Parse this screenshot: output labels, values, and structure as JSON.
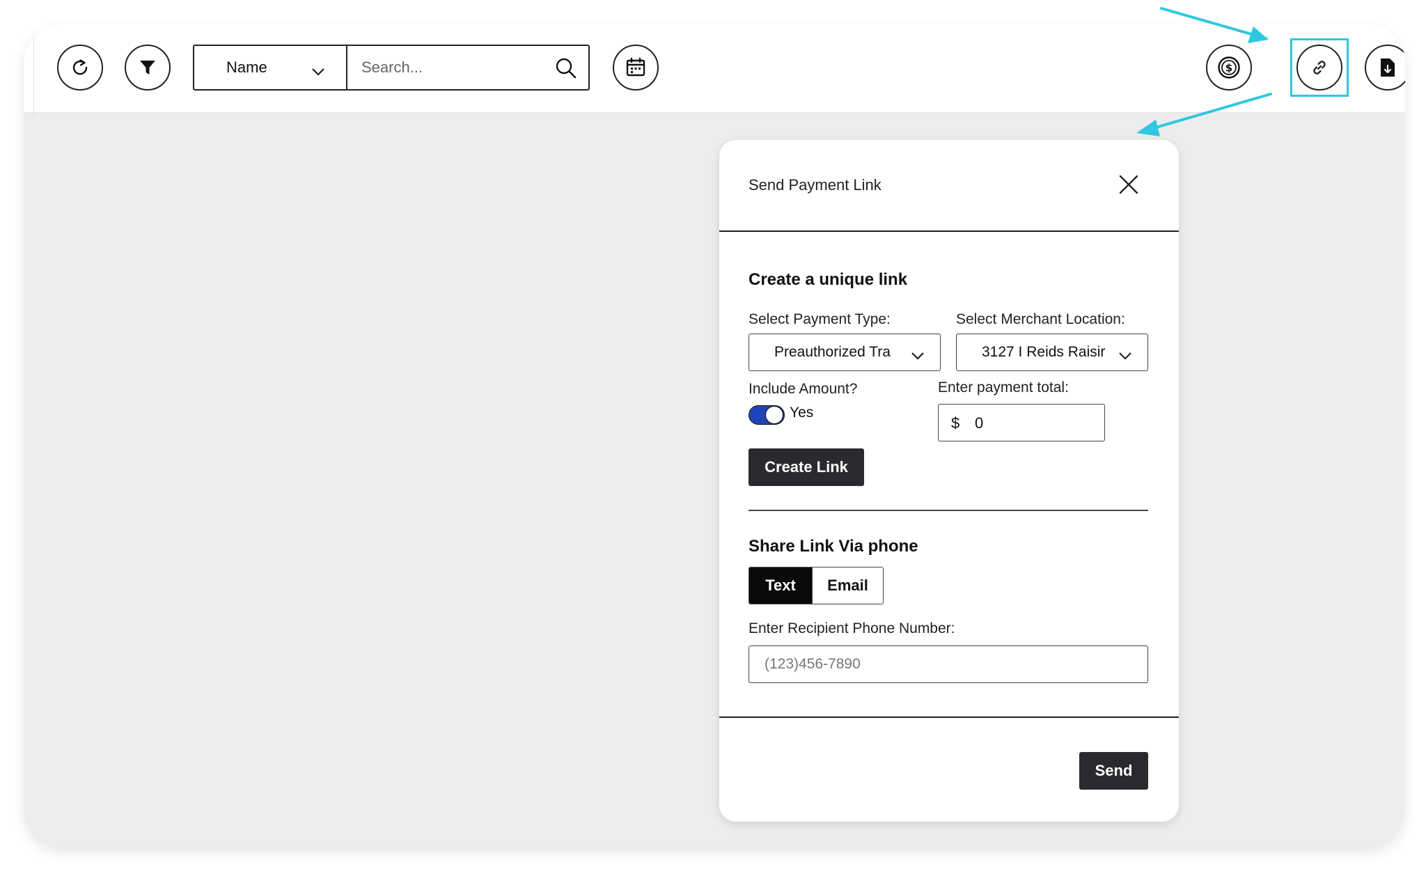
{
  "toolbar": {
    "search_select_value": "Name",
    "search_placeholder": "Search...",
    "icons": [
      "refresh-icon",
      "filter-icon",
      "chevron-down-icon",
      "search-icon",
      "calendar-icon",
      "dollar-coin-icon",
      "link-icon",
      "document-download-icon"
    ]
  },
  "modal": {
    "title": "Send Payment Link",
    "section_create_title": "Create a unique link",
    "payment_type_label": "Select Payment Type:",
    "payment_type_value": "Preauthorized Tra",
    "merchant_location_label": "Select Merchant Location:",
    "merchant_location_value": "3127 I Reids Raisir",
    "include_amount_label": "Include Amount?",
    "include_amount_toggle_text": "Yes",
    "include_amount_on": true,
    "payment_total_label": "Enter payment total:",
    "payment_total_currency": "$",
    "payment_total_value": "0",
    "create_link_button": "Create Link",
    "section_share_title": "Share Link Via phone",
    "share_tabs": [
      {
        "label": "Text",
        "active": true
      },
      {
        "label": "Email",
        "active": false
      }
    ],
    "phone_label": "Enter Recipient Phone Number:",
    "phone_placeholder": "(123)456-7890",
    "send_button": "Send"
  },
  "colors": {
    "accent_highlight": "#2fc8e0",
    "toggle_on": "#1f43b8",
    "dark_button": "#2a2a2e",
    "app_background": "#ededee"
  }
}
